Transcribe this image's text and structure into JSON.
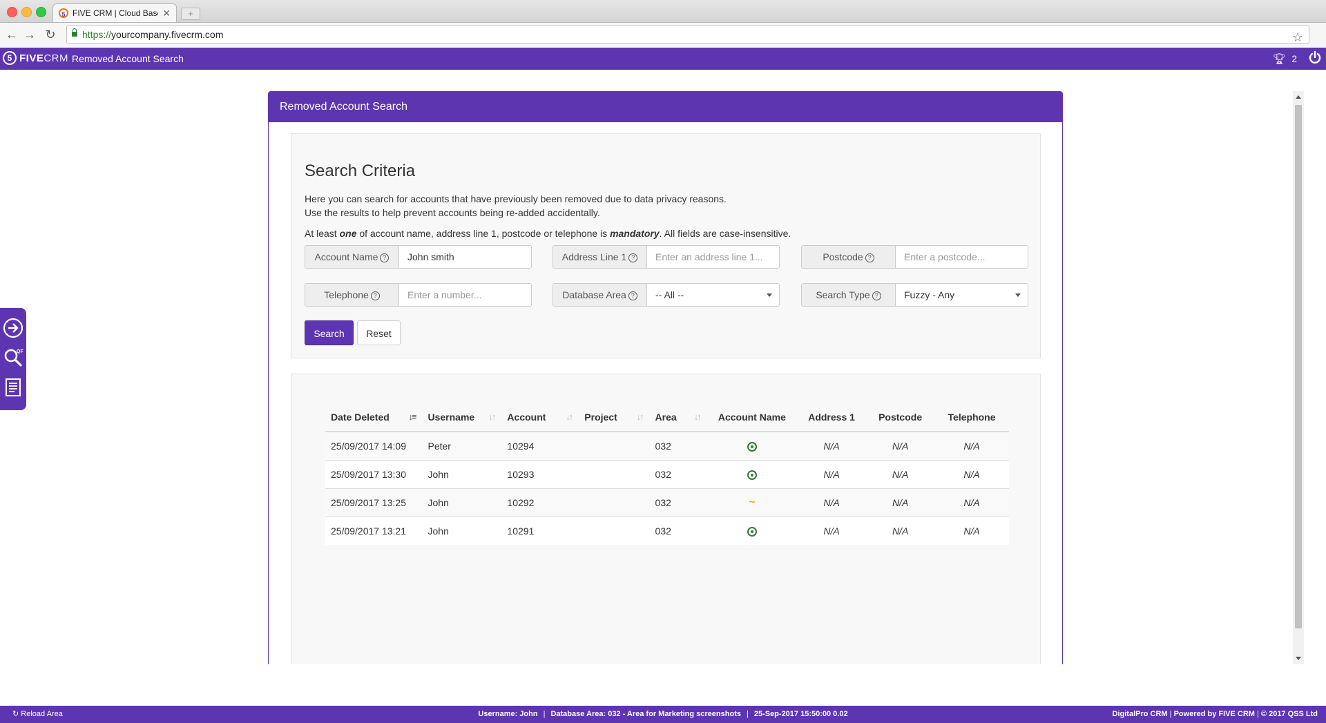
{
  "browser": {
    "tab_title": "FIVE CRM | Cloud Based Sa",
    "url_scheme": "https://",
    "url_host": "yourcompany.fivecrm.com"
  },
  "app": {
    "logo_five": "FIVE",
    "logo_crm": "CRM",
    "page_title": "Removed Account Search",
    "trophy_count": "2"
  },
  "panel": {
    "heading": "Removed Account Search"
  },
  "criteria": {
    "title": "Search Criteria",
    "line1": "Here you can search for accounts that have previously been removed due to data privacy reasons.",
    "line2": "Use the results to help prevent accounts being re-added accidentally.",
    "line3_pre": "At least ",
    "line3_em1": "one",
    "line3_mid": " of account name, address line 1, postcode or telephone is ",
    "line3_em2": "mandatory",
    "line3_post": ". All fields are case-insensitive.",
    "fields": {
      "account_name": {
        "label": "Account Name",
        "value": "John smith",
        "placeholder": ""
      },
      "address_line1": {
        "label": "Address Line 1",
        "value": "",
        "placeholder": "Enter an address line 1..."
      },
      "postcode": {
        "label": "Postcode",
        "value": "",
        "placeholder": "Enter a postcode..."
      },
      "telephone": {
        "label": "Telephone",
        "value": "",
        "placeholder": "Enter a number..."
      },
      "database_area": {
        "label": "Database Area",
        "value": "-- All --"
      },
      "search_type": {
        "label": "Search Type",
        "value": "Fuzzy - Any"
      }
    },
    "search_button": "Search",
    "reset_button": "Reset"
  },
  "results": {
    "columns": [
      "Date Deleted",
      "Username",
      "Account",
      "Project",
      "Area",
      "Account Name",
      "Address 1",
      "Postcode",
      "Telephone"
    ],
    "rows": [
      {
        "date": "25/09/2017 14:09",
        "username": "Peter",
        "account": "10294",
        "project": "",
        "area": "032",
        "account_name_icon": "match-target-icon",
        "address1": "N/A",
        "postcode": "N/A",
        "telephone": "N/A"
      },
      {
        "date": "25/09/2017 13:30",
        "username": "John",
        "account": "10293",
        "project": "",
        "area": "032",
        "account_name_icon": "match-target-icon",
        "address1": "N/A",
        "postcode": "N/A",
        "telephone": "N/A"
      },
      {
        "date": "25/09/2017 13:25",
        "username": "John",
        "account": "10292",
        "project": "",
        "area": "032",
        "account_name_icon": "fuzzy-match-icon",
        "address1": "N/A",
        "postcode": "N/A",
        "telephone": "N/A"
      },
      {
        "date": "25/09/2017 13:21",
        "username": "John",
        "account": "10291",
        "project": "",
        "area": "032",
        "account_name_icon": "match-target-icon",
        "address1": "N/A",
        "postcode": "N/A",
        "telephone": "N/A"
      }
    ],
    "fuzzy_symbol": "~"
  },
  "footer": {
    "reload": "Reload Area",
    "username": "Username: John",
    "database_area": "Database Area: 032 - Area for Marketing screenshots",
    "datetime": "25-Sep-2017 15:50:00 0.02",
    "brand": "DigitalPro CRM",
    "powered": "Powered by FIVE CRM",
    "copyright": "© 2017 QSS Ltd"
  },
  "colors": {
    "brand_purple": "#5e35b1",
    "match_green": "#2e7d32",
    "fuzzy_orange": "#f0a020"
  }
}
